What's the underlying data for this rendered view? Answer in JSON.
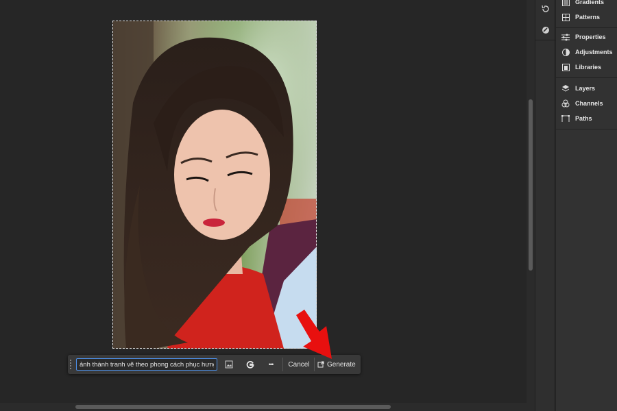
{
  "panel": {
    "items": [
      {
        "label": "Gradients"
      },
      {
        "label": "Patterns"
      },
      {
        "label": "Properties"
      },
      {
        "label": "Adjustments"
      },
      {
        "label": "Libraries"
      },
      {
        "label": "Layers"
      },
      {
        "label": "Channels"
      },
      {
        "label": "Paths"
      }
    ]
  },
  "task_bar": {
    "prompt_value": "ảnh thành tranh vẽ theo phong cách phục hưng",
    "cancel_label": "Cancel",
    "generate_label": "Generate",
    "more_label": "•••"
  },
  "colors": {
    "accent": "#4d8fe8",
    "arrow": "#e8100f",
    "panel_bg": "#323232",
    "canvas_bg": "#262626"
  }
}
